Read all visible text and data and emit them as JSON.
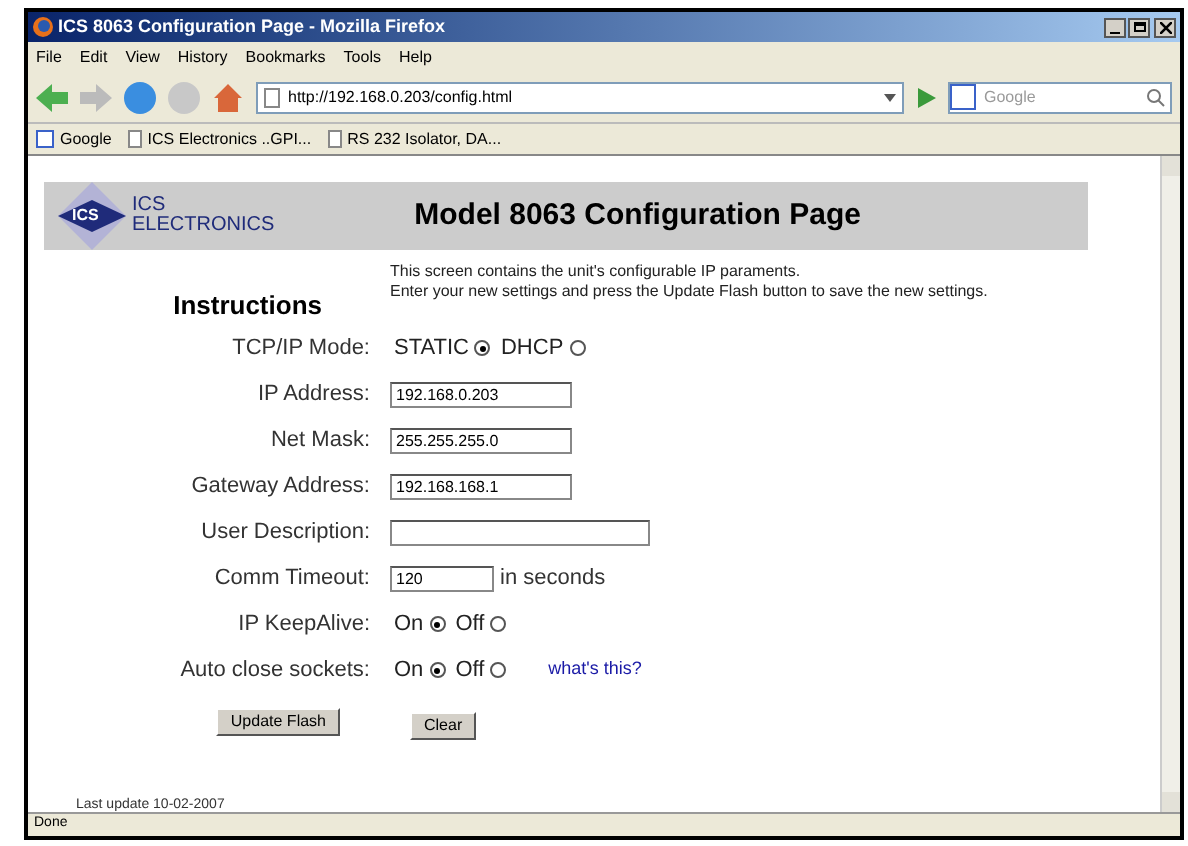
{
  "window": {
    "title": "ICS 8063 Configuration Page - Mozilla Firefox"
  },
  "menu": [
    "File",
    "Edit",
    "View",
    "History",
    "Bookmarks",
    "Tools",
    "Help"
  ],
  "address": {
    "value": "http://192.168.0.203/config.html"
  },
  "search": {
    "placeholder": "Google"
  },
  "bookmarks": [
    {
      "label": "Google",
      "kind": "google"
    },
    {
      "label": "ICS Electronics ..GPI...",
      "kind": "page"
    },
    {
      "label": "RS 232 Isolator, DA...",
      "kind": "page"
    }
  ],
  "page": {
    "logo": {
      "mark": "ICS",
      "line1": "ICS",
      "line2": "ELECTRONICS"
    },
    "heading": "Model 8063 Configuration Page",
    "instructions_title": "Instructions",
    "instructions": [
      "This screen contains the unit's configurable IP paraments.",
      "Enter your new settings and press the Update Flash button to save the new settings."
    ],
    "fields": [
      {
        "kind": "radio",
        "label": "TCP/IP Mode:",
        "options": [
          {
            "label": "STATIC",
            "selected": true
          },
          {
            "label": "DHCP",
            "selected": false
          }
        ]
      },
      {
        "kind": "text",
        "label": "IP Address:",
        "value": "192.168.0.203"
      },
      {
        "kind": "text",
        "label": "Net Mask:",
        "value": "255.255.255.0"
      },
      {
        "kind": "text",
        "label": "Gateway Address:",
        "value": "192.168.168.1"
      },
      {
        "kind": "text",
        "label": "User Description:"
      },
      {
        "kind": "text",
        "label": "Comm Timeout:",
        "value": "120",
        "suffix": "in seconds"
      },
      {
        "kind": "radio",
        "label": "IP KeepAlive:",
        "options": [
          {
            "label": "On",
            "selected": true
          },
          {
            "label": "Off",
            "selected": false
          }
        ]
      },
      {
        "kind": "radio",
        "label": "Auto close sockets:",
        "options": [
          {
            "label": "On",
            "selected": true
          },
          {
            "label": "Off",
            "selected": false
          }
        ],
        "link": "what's this?"
      }
    ],
    "buttons": [
      "Update Flash",
      "Clear"
    ],
    "footer": "Last update 10-02-2007"
  },
  "status_bar": "Done"
}
